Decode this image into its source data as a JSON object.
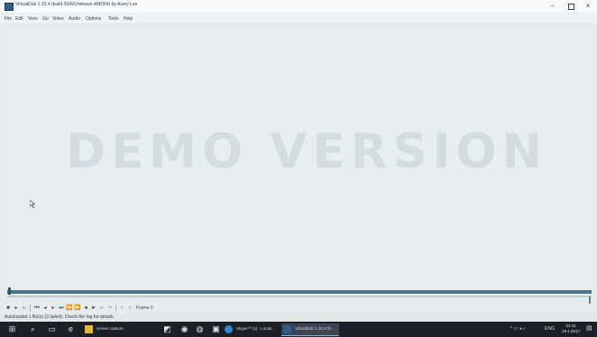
{
  "window": {
    "title": "VirtualDub 1.10.4 (build 35491/release-AMD64) by Avery Lee",
    "minimize_icon": "–",
    "close_icon": "×"
  },
  "menu": [
    "File",
    "Edit",
    "View",
    "Go",
    "Video",
    "Audio",
    "Options",
    "Tools",
    "Help"
  ],
  "workarea": {
    "watermark": "DEMO VERSION"
  },
  "position": {
    "frame_label": "Frame 0"
  },
  "status": {
    "message": "Autoloaded 1 file(s) (2 failed). Check the log for details."
  },
  "taskbar": {
    "search_label": "screen capture",
    "app_chrome_label": "Skype™ [1] - Locati...",
    "app_vdub_label": "VirtualDub 1.10.4 (b...",
    "tray_text": "ENG",
    "clock_time": "22:41",
    "clock_date": "19.1.2017"
  },
  "colors": {
    "accent": "#4f7285",
    "taskbar": "#1b1f26",
    "workarea": "#e8edf0"
  }
}
